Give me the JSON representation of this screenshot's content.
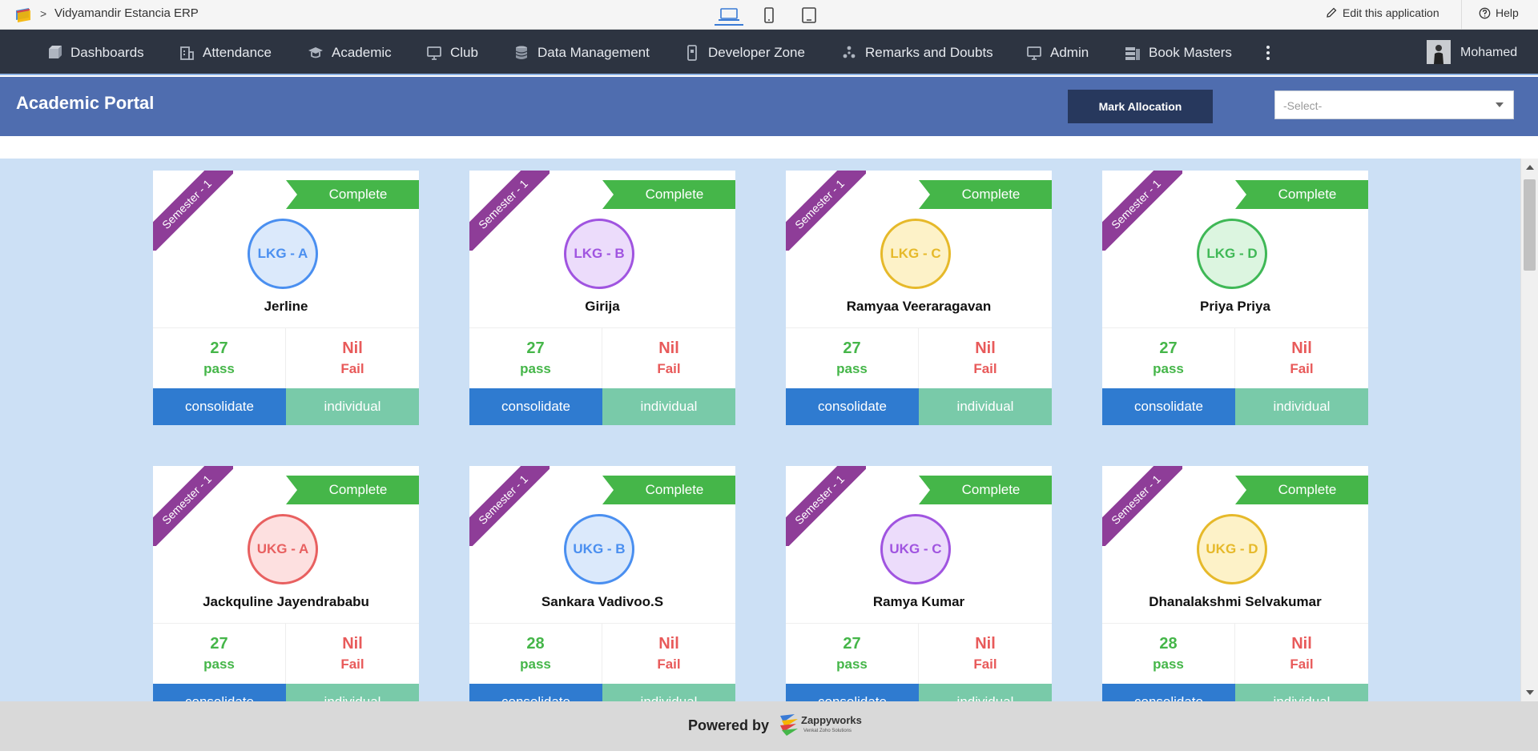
{
  "topbar": {
    "app_title": "Vidyamandir Estancia ERP",
    "breadcrumb_separator": ">",
    "edit_label": "Edit this application",
    "help_label": "Help"
  },
  "nav": {
    "items": [
      {
        "label": "Dashboards",
        "icon": "cube-icon"
      },
      {
        "label": "Attendance",
        "icon": "building-icon"
      },
      {
        "label": "Academic",
        "icon": "graduation-cap-icon"
      },
      {
        "label": "Club",
        "icon": "monitor-icon"
      },
      {
        "label": "Data Management",
        "icon": "database-icon"
      },
      {
        "label": "Developer Zone",
        "icon": "mobile-icon"
      },
      {
        "label": "Remarks and Doubts",
        "icon": "asterisk-icon"
      },
      {
        "label": "Admin",
        "icon": "monitor-icon"
      },
      {
        "label": "Book Masters",
        "icon": "books-icon"
      }
    ],
    "user_name": "Mohamed"
  },
  "portal": {
    "title": "Academic Portal",
    "mark_allocation_label": "Mark Allocation",
    "select_placeholder": "-Select-"
  },
  "cards": [
    {
      "semester": "Semester - 1",
      "status": "Complete",
      "class": "LKG - A",
      "teacher": "Jerline",
      "pass_count": "27",
      "pass_label": "pass",
      "fail_count": "Nil",
      "fail_label": "Fail",
      "consolidate_label": "consolidate",
      "individual_label": "individual",
      "circle_color": "#4a8ff0",
      "circle_fill": "#dbe9fb"
    },
    {
      "semester": "Semester - 1",
      "status": "Complete",
      "class": "LKG - B",
      "teacher": "Girija",
      "pass_count": "27",
      "pass_label": "pass",
      "fail_count": "Nil",
      "fail_label": "Fail",
      "consolidate_label": "consolidate",
      "individual_label": "individual",
      "circle_color": "#a054e0",
      "circle_fill": "#ecdcfb"
    },
    {
      "semester": "Semester - 1",
      "status": "Complete",
      "class": "LKG - C",
      "teacher": "Ramyaa Veeraragavan",
      "pass_count": "27",
      "pass_label": "pass",
      "fail_count": "Nil",
      "fail_label": "Fail",
      "consolidate_label": "consolidate",
      "individual_label": "individual",
      "circle_color": "#e6b92a",
      "circle_fill": "#fdf2c8"
    },
    {
      "semester": "Semester - 1",
      "status": "Complete",
      "class": "LKG - D",
      "teacher": "Priya Priya",
      "pass_count": "27",
      "pass_label": "pass",
      "fail_count": "Nil",
      "fail_label": "Fail",
      "consolidate_label": "consolidate",
      "individual_label": "individual",
      "circle_color": "#3fb856",
      "circle_fill": "#dcf5e0"
    },
    {
      "semester": "Semester - 1",
      "status": "Complete",
      "class": "UKG - A",
      "teacher": "Jackquline Jayendrababu",
      "pass_count": "27",
      "pass_label": "pass",
      "fail_count": "Nil",
      "fail_label": "Fail",
      "consolidate_label": "consolidate",
      "individual_label": "individual",
      "circle_color": "#e86060",
      "circle_fill": "#fde0e0"
    },
    {
      "semester": "Semester - 1",
      "status": "Complete",
      "class": "UKG - B",
      "teacher": "Sankara Vadivoo.S",
      "pass_count": "28",
      "pass_label": "pass",
      "fail_count": "Nil",
      "fail_label": "Fail",
      "consolidate_label": "consolidate",
      "individual_label": "individual",
      "circle_color": "#4a8ff0",
      "circle_fill": "#dbe9fb"
    },
    {
      "semester": "Semester - 1",
      "status": "Complete",
      "class": "UKG - C",
      "teacher": "Ramya Kumar",
      "pass_count": "27",
      "pass_label": "pass",
      "fail_count": "Nil",
      "fail_label": "Fail",
      "consolidate_label": "consolidate",
      "individual_label": "individual",
      "circle_color": "#a054e0",
      "circle_fill": "#ecdcfb"
    },
    {
      "semester": "Semester - 1",
      "status": "Complete",
      "class": "UKG - D",
      "teacher": "Dhanalakshmi Selvakumar",
      "pass_count": "28",
      "pass_label": "pass",
      "fail_count": "Nil",
      "fail_label": "Fail",
      "consolidate_label": "consolidate",
      "individual_label": "individual",
      "circle_color": "#e6b92a",
      "circle_fill": "#fdf2c8"
    }
  ],
  "footer": {
    "powered_by": "Powered by",
    "brand": "Zappyworks",
    "brand_sub": "Venkat  Zoho  Solutions"
  },
  "colors": {
    "nav_bg": "#2d3441",
    "portal_header": "#4f6daf",
    "content_bg": "#cce0f5",
    "ribbon": "#8e3d98",
    "complete": "#45b649",
    "pass": "#45b649",
    "fail": "#e85a5a",
    "consolidate": "#2f7bd0",
    "individual": "#79caa9"
  }
}
